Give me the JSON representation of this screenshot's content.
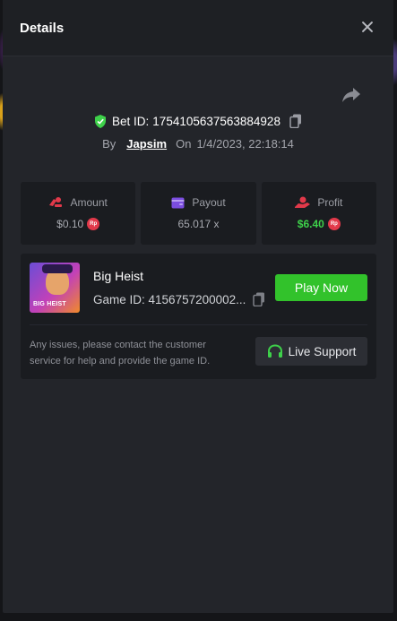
{
  "modal": {
    "title": "Details"
  },
  "bet": {
    "label": "Bet ID:",
    "id": "1754105637563884928",
    "by_label": "By",
    "user": "Japsim",
    "on_label": "On",
    "datetime": "1/4/2023, 22:18:14"
  },
  "stats": [
    {
      "label": "Amount",
      "value": "$0.10",
      "currency_badge": "Rp",
      "icon": "coins-icon"
    },
    {
      "label": "Payout",
      "value": "65.017 x",
      "icon": "wallet-icon"
    },
    {
      "label": "Profit",
      "value": "$6.40",
      "currency_badge": "Rp",
      "icon": "profit-hand-icon",
      "value_color": "#3ed14a"
    }
  ],
  "game": {
    "name": "Big Heist",
    "id_label": "Game ID:",
    "id": "4156757200002...",
    "thumbnail_text": "BIG HEIST",
    "play_label": "Play Now"
  },
  "support": {
    "text": "Any issues, please contact the customer service for help and provide the game ID.",
    "button_label": "Live Support"
  },
  "colors": {
    "accent_green": "#32c22b",
    "profit_green": "#3ed14a",
    "badge_red": "#e2394a",
    "panel_bg": "#23252a"
  }
}
